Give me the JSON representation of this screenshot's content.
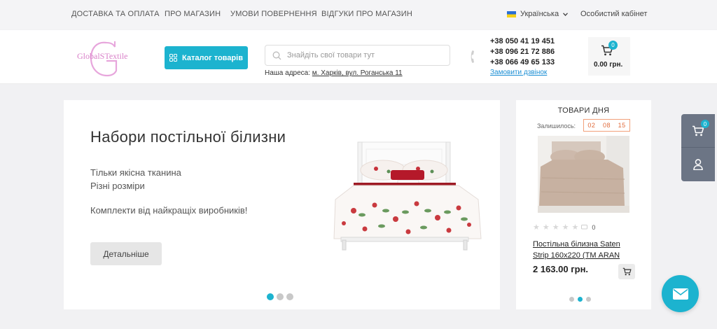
{
  "topbar": {
    "nav": [
      "ДОСТАВКА ТА ОПЛАТА",
      "ПРО МАГАЗИН",
      "УМОВИ ПОВЕРНЕННЯ",
      "ВІДГУКИ ПРО МАГАЗИН"
    ],
    "language": "Українська",
    "cabinet": "Особистий кабінет"
  },
  "header": {
    "logo_text": "GlobalSTextile",
    "catalog_label": "Каталог товарів",
    "search_placeholder": "Знайдіть свої товари тут",
    "address_prefix": "Наша адреса:",
    "address_link": "м. Харків, вул. Роганська 11",
    "phones": [
      "+38 050 41 19 451",
      "+38 096 21 72 886",
      "+38 066 49 65 133"
    ],
    "callback": "Замовити дзвінок",
    "cart_count": "0",
    "cart_total": "0.00 грн."
  },
  "slider": {
    "title": "Набори постільної білизни",
    "lines": [
      "Тільки якісна тканина",
      "Різні розміри",
      "Комплекти від найкращіх виробників!"
    ],
    "button": "Детальніше"
  },
  "deals": {
    "title": "ТОВАРИ ДНЯ",
    "left_label": "Залишилось:",
    "timer": [
      "02",
      "08",
      "15"
    ],
    "rating_count": "0",
    "product_name": "Постільна білизна Saten Strip 160x220 (ТМ ARAN",
    "price": "2 163.00 грн."
  },
  "floating": {
    "cart_count": "0"
  },
  "colors": {
    "accent": "#1cb3cf",
    "panel": "#6c7585",
    "timer": "#e06a3a",
    "logo": "#d97fc8"
  }
}
